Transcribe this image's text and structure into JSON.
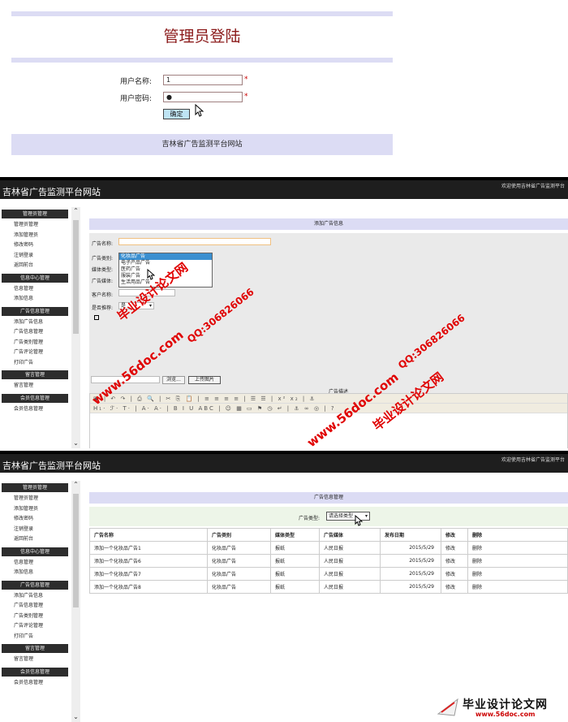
{
  "login": {
    "title": "管理员登陆",
    "username_label": "用户名称:",
    "username_value": "1",
    "password_label": "用户密码:",
    "password_value": "●",
    "required_mark": "*",
    "submit_label": "确定",
    "footer": "吉林省广告监测平台网站"
  },
  "app": {
    "site_title": "吉林省广告监测平台网站",
    "welcome": "欢迎使用吉林省广告监测平台"
  },
  "sidebar": {
    "groups": [
      {
        "title": "管理员管理",
        "items": [
          "管理员管理",
          "添加管理员",
          "修改密码",
          "注销登录",
          "返回前台"
        ]
      },
      {
        "title": "信息中心管理",
        "items": [
          "信息管理",
          "添加信息"
        ]
      },
      {
        "title": "广告信息管理",
        "items": [
          "添加广告信息",
          "广告信息管理",
          "广告类别管理",
          "广告评论管理",
          "打印广告"
        ]
      },
      {
        "title": "留言管理",
        "items": [
          "留言管理"
        ]
      },
      {
        "title": "会员信息管理",
        "items": [
          "会员信息管理"
        ]
      }
    ]
  },
  "add_form": {
    "heading": "添加广告信息",
    "name_label": "广告名称:",
    "category_label": "广告类别:",
    "category_options": [
      "化妆品广告",
      "电子产品广告",
      "医药广告",
      "服装广告",
      "生活用品广告"
    ],
    "media_type_label": "媒体类型:",
    "media_label": "广告媒体:",
    "client_label": "客户名称:",
    "recommend_label": "是否推荐:",
    "recommend_value": "是",
    "browse_label": "浏览...",
    "upload_label": "上传图片",
    "detail_label": "广告描述",
    "toolbar_row1": "▣ | ↶ ↷ | ⎙ 🔍 | ✂ ⎘ 📋 | ≡ ≡ ≡ ≡ | ☰ ☰ | x² x₂ | ⚓",
    "toolbar_row2": "H₁· ℱ· T· | A· A· | B I U ABC | ☺ ▦ ▭ ⚑ ◷ ↵ | ⚓ ∞ ◎ | ?"
  },
  "manage": {
    "heading": "广告信息管理",
    "filter_label": "广告类型:",
    "filter_value": "请选择类型",
    "columns": [
      "广告名称",
      "广告类别",
      "媒体类型",
      "广告媒体",
      "发布日期",
      "修改",
      "删除"
    ],
    "rows": [
      [
        "添加一个化妆品广告1",
        "化妆品广告",
        "报纸",
        "人民日报",
        "2015/5/29",
        "修改",
        "删除"
      ],
      [
        "添加一个化妆品广告6",
        "化妆品广告",
        "报纸",
        "人民日报",
        "2015/5/29",
        "修改",
        "删除"
      ],
      [
        "添加一个化妆品广告7",
        "化妆品广告",
        "报纸",
        "人民日报",
        "2015/5/29",
        "修改",
        "删除"
      ],
      [
        "添加一个化妆品广告8",
        "化妆品广告",
        "报纸",
        "人民日报",
        "2015/5/29",
        "修改",
        "删除"
      ]
    ]
  },
  "watermark": {
    "brand": "毕业设计论文网",
    "url": "www.56doc.com",
    "qq": "QQ:306826066",
    "logo_text": "毕业设计论文网",
    "logo_url": "www.56doc.com"
  }
}
